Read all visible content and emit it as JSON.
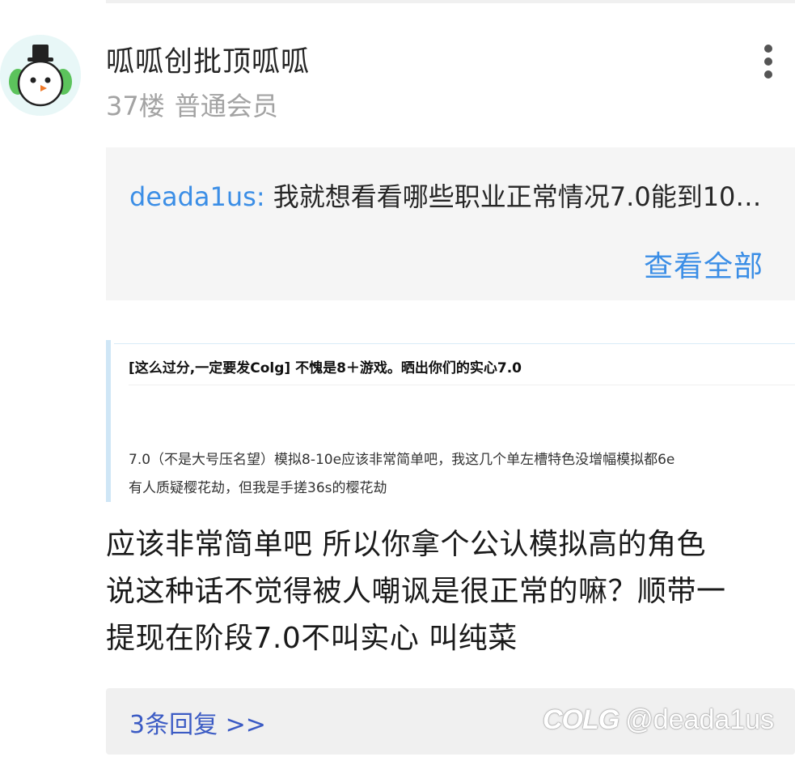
{
  "post": {
    "username": "呱呱创批顶呱呱",
    "floor": "37楼",
    "member_level": "普通会员",
    "more_icon": "more-vertical-icon"
  },
  "quote": {
    "user": "deada1us:",
    "text": "我就想看看哪些职业正常情况7.0能到10…",
    "view_all": "查看全部"
  },
  "embed": {
    "title": "[这么过分,一定要发Colg] 不愧是8＋游戏。晒出你们的实心7.0",
    "line1": "7.0（不是大号压名望）模拟8-10e应该非常简单吧，我这几个单左槽特色没增幅模拟都6e",
    "line2": "有人质疑樱花劫，但我是手搓36s的樱花劫"
  },
  "body": {
    "lines": [
      "应该非常简单吧  所以你拿个公认模拟高的角色",
      "说这种话不觉得被人嘲讽是很正常的嘛？顺带一",
      "提现在阶段7.0不叫实心 叫纯菜"
    ]
  },
  "replies": {
    "label": "3条回复 >>"
  },
  "watermark": {
    "logo": "COLG",
    "handle": "@deada1us"
  },
  "colors": {
    "link_blue": "#3b8ee6",
    "reply_blue": "#3b5bc4",
    "muted_gray": "#a3a3a3"
  }
}
